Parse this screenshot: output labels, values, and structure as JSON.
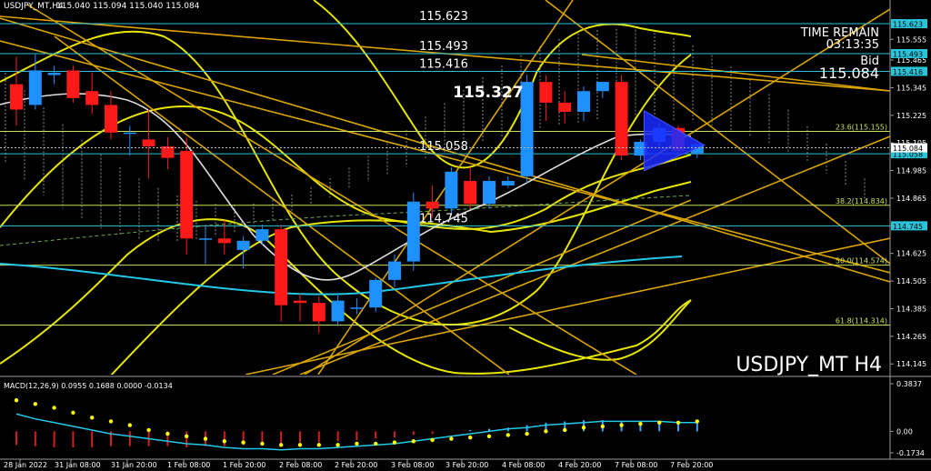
{
  "header": {
    "symbol_info": "USDJPY_MT,H4",
    "ohlc": "115.040 115.094 115.040 115.084"
  },
  "time_remain": {
    "label": "TIME REMAIN",
    "value": "03:13:35"
  },
  "bid": {
    "label": "Bid",
    "value": "115.084"
  },
  "watermark": "USDJPY_MT H4",
  "macd_label": "MACD(12,26,9) 0.0955 0.1688 0.0000 -0.0134",
  "colors": {
    "background": "#000000",
    "bull": "#1e90ff",
    "bear": "#ff1a1a",
    "level": "#ffff66",
    "bollinger": "#e6e600",
    "fib": "#c8e05a",
    "trend": "#d8a500",
    "cyan_ma": "#22c8e6",
    "white_ma": "#dddddd",
    "histogram_bear": "#d02020",
    "histogram_bull": "#3aa8ff",
    "signal_dots": "#ffff00"
  },
  "chart_data": {
    "type": "candlestick",
    "title": "USDJPY_MT H4",
    "ylim": [
      114.0985,
      115.6785
    ],
    "right_axis_ticks": [
      "115.555",
      "115.465",
      "115.345",
      "115.225",
      "115.105",
      "114.985",
      "114.865",
      "114.745",
      "114.625",
      "114.505",
      "114.385",
      "114.265",
      "114.145"
    ],
    "x_labels": [
      "28 Jan 2022",
      "31 Jan 08:00",
      "31 Jan 20:00",
      "1 Feb 08:00",
      "1 Feb 20:00",
      "2 Feb 08:00",
      "2 Feb 20:00",
      "3 Feb 08:00",
      "3 Feb 20:00",
      "4 Feb 08:00",
      "4 Feb 20:00",
      "7 Feb 08:00",
      "7 Feb 20:00"
    ],
    "candles": [
      {
        "o": 115.36,
        "h": 115.48,
        "c": 115.25,
        "l": 115.18
      },
      {
        "o": 115.27,
        "h": 115.49,
        "c": 115.42,
        "l": 115.25
      },
      {
        "o": 115.4,
        "h": 115.44,
        "c": 115.41,
        "l": 115.36
      },
      {
        "o": 115.42,
        "h": 115.44,
        "c": 115.3,
        "l": 115.28
      },
      {
        "o": 115.33,
        "h": 115.41,
        "c": 115.27,
        "l": 115.23
      },
      {
        "o": 115.27,
        "h": 115.33,
        "c": 115.15,
        "l": 115.12
      },
      {
        "o": 115.15,
        "h": 115.18,
        "c": 115.15,
        "l": 115.05
      },
      {
        "o": 115.12,
        "h": 115.25,
        "c": 115.09,
        "l": 114.95
      },
      {
        "o": 115.09,
        "h": 115.13,
        "c": 115.04,
        "l": 114.99
      },
      {
        "o": 115.07,
        "h": 115.13,
        "c": 114.69,
        "l": 114.62
      },
      {
        "o": 114.69,
        "h": 114.75,
        "c": 114.69,
        "l": 114.58
      },
      {
        "o": 114.69,
        "h": 114.77,
        "c": 114.67,
        "l": 114.62
      },
      {
        "o": 114.64,
        "h": 114.7,
        "c": 114.68,
        "l": 114.56
      },
      {
        "o": 114.68,
        "h": 114.75,
        "c": 114.73,
        "l": 114.66
      },
      {
        "o": 114.73,
        "h": 114.75,
        "c": 114.4,
        "l": 114.33
      },
      {
        "o": 114.42,
        "h": 114.45,
        "c": 114.41,
        "l": 114.33
      },
      {
        "o": 114.41,
        "h": 114.44,
        "c": 114.33,
        "l": 114.28
      },
      {
        "o": 114.33,
        "h": 114.45,
        "c": 114.42,
        "l": 114.31
      },
      {
        "o": 114.39,
        "h": 114.43,
        "c": 114.39,
        "l": 114.36
      },
      {
        "o": 114.39,
        "h": 114.52,
        "c": 114.51,
        "l": 114.37
      },
      {
        "o": 114.51,
        "h": 114.62,
        "c": 114.59,
        "l": 114.48
      },
      {
        "o": 114.59,
        "h": 114.89,
        "c": 114.85,
        "l": 114.55
      },
      {
        "o": 114.85,
        "h": 114.92,
        "c": 114.82,
        "l": 114.78
      },
      {
        "o": 114.82,
        "h": 115.0,
        "c": 114.98,
        "l": 114.8
      },
      {
        "o": 114.94,
        "h": 115.0,
        "c": 114.84,
        "l": 114.82
      },
      {
        "o": 114.84,
        "h": 114.96,
        "c": 114.94,
        "l": 114.82
      },
      {
        "o": 114.92,
        "h": 114.96,
        "c": 114.94,
        "l": 114.91
      },
      {
        "o": 114.96,
        "h": 115.4,
        "c": 115.37,
        "l": 114.93
      },
      {
        "o": 115.37,
        "h": 115.4,
        "c": 115.28,
        "l": 115.2
      },
      {
        "o": 115.28,
        "h": 115.33,
        "c": 115.24,
        "l": 115.19
      },
      {
        "o": 115.24,
        "h": 115.35,
        "c": 115.33,
        "l": 115.2
      },
      {
        "o": 115.33,
        "h": 115.37,
        "c": 115.37,
        "l": 115.3
      },
      {
        "o": 115.37,
        "h": 115.4,
        "c": 115.05,
        "l": 115.03
      },
      {
        "o": 115.05,
        "h": 115.12,
        "c": 115.11,
        "l": 115.03
      },
      {
        "o": 115.11,
        "h": 115.19,
        "c": 115.17,
        "l": 115.09
      },
      {
        "o": 115.17,
        "h": 115.18,
        "c": 115.07,
        "l": 115.05
      },
      {
        "o": 115.06,
        "h": 115.1,
        "c": 115.1,
        "l": 115.04
      }
    ],
    "horizontal_levels": [
      {
        "price": 115.623,
        "label": "115.623",
        "axis_box": "115.623"
      },
      {
        "price": 115.493,
        "label": "115.493",
        "axis_box": "115.493"
      },
      {
        "price": 115.416,
        "label": "115.416",
        "axis_box": "115.416"
      },
      {
        "price": 115.058,
        "label": "115.058",
        "axis_box": "115.058"
      },
      {
        "price": 114.745,
        "label": "114.745",
        "axis_box": "114.745"
      }
    ],
    "fibonacci_levels": [
      {
        "price": 115.155,
        "label": "23.6(115.155)"
      },
      {
        "price": 114.834,
        "label": "38.2(114.834)"
      },
      {
        "price": 114.574,
        "label": "50.0(114.574)"
      },
      {
        "price": 114.314,
        "label": "61.8(114.314)"
      }
    ],
    "high_label": {
      "price": 115.327,
      "label": "115.327"
    },
    "current_price": {
      "price": 115.084,
      "axis_box": "115.084"
    },
    "macd": {
      "ylim": [
        -0.1734,
        0.3837
      ],
      "ticks": [
        "0.3837",
        "0.00",
        "-0.1734"
      ],
      "histogram": [
        -0.11,
        -0.12,
        -0.13,
        -0.13,
        -0.13,
        -0.12,
        -0.12,
        -0.12,
        -0.12,
        -0.13,
        -0.12,
        -0.12,
        -0.11,
        -0.1,
        -0.1,
        -0.09,
        -0.09,
        -0.08,
        -0.07,
        -0.06,
        -0.05,
        -0.03,
        -0.02,
        0.0,
        0.01,
        0.02,
        0.03,
        0.05,
        0.07,
        0.08,
        0.09,
        0.09,
        0.08,
        0.08,
        0.08,
        0.07,
        0.07
      ],
      "signal": [
        0.25,
        0.22,
        0.19,
        0.15,
        0.11,
        0.08,
        0.05,
        0.01,
        -0.02,
        -0.04,
        -0.06,
        -0.08,
        -0.09,
        -0.1,
        -0.11,
        -0.11,
        -0.11,
        -0.11,
        -0.1,
        -0.1,
        -0.09,
        -0.08,
        -0.07,
        -0.06,
        -0.05,
        -0.04,
        -0.03,
        -0.02,
        0.0,
        0.01,
        0.03,
        0.04,
        0.05,
        0.06,
        0.07,
        0.07,
        0.08
      ],
      "macd_line": [
        0.14,
        0.1,
        0.07,
        0.04,
        0.01,
        -0.02,
        -0.04,
        -0.06,
        -0.08,
        -0.1,
        -0.11,
        -0.13,
        -0.14,
        -0.14,
        -0.15,
        -0.14,
        -0.14,
        -0.13,
        -0.12,
        -0.11,
        -0.1,
        -0.08,
        -0.06,
        -0.04,
        -0.02,
        0.0,
        0.02,
        0.03,
        0.05,
        0.06,
        0.07,
        0.08,
        0.08,
        0.08,
        0.08,
        0.07,
        0.07
      ]
    }
  }
}
